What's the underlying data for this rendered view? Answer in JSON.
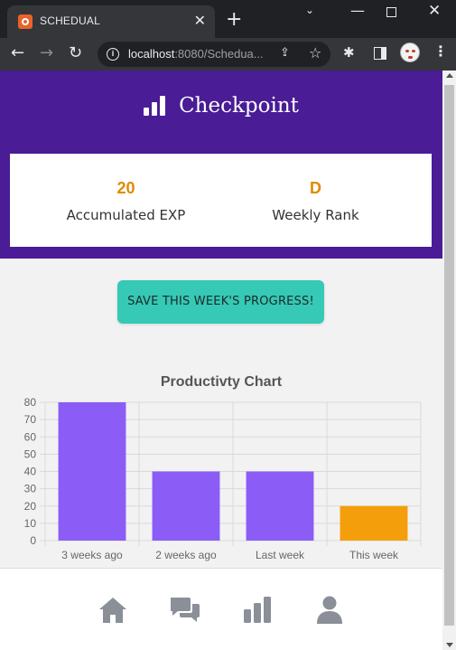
{
  "browser": {
    "tab_title": "SCHEDUAL",
    "url_host": "localhost",
    "url_rest": ":8080/Schedua...",
    "close_glyph": "✕",
    "new_tab_glyph": "+",
    "dropdown_glyph": "⌄",
    "min_glyph": "—",
    "win_close_glyph": "✕",
    "back_glyph": "←",
    "fwd_glyph": "→",
    "reload_glyph": "↻",
    "share_glyph": "⇪",
    "star_glyph": "☆",
    "puzzle_glyph": "✱",
    "menu_glyph": "⋮",
    "info_glyph": "i"
  },
  "header": {
    "title": "Checkpoint",
    "icon": "bar-chart-icon"
  },
  "stats": {
    "exp_value": "20",
    "exp_label": "Accumulated EXP",
    "rank_value": "D",
    "rank_label": "Weekly Rank"
  },
  "actions": {
    "save_label": "SAVE THIS WEEK'S PROGRESS!"
  },
  "chart_data": {
    "type": "bar",
    "title": "Productivty Chart",
    "categories": [
      "3 weeks ago",
      "2 weeks ago",
      "Last week",
      "This week"
    ],
    "values": [
      80,
      40,
      40,
      20
    ],
    "colors": [
      "#8b5cf6",
      "#8b5cf6",
      "#8b5cf6",
      "#f59e0b"
    ],
    "ylim": [
      0,
      80
    ],
    "yticks": [
      0,
      10,
      20,
      30,
      40,
      50,
      60,
      70,
      80
    ],
    "grid": true
  },
  "bottom_nav": [
    {
      "name": "home-icon"
    },
    {
      "name": "chat-icon"
    },
    {
      "name": "bar-chart-icon"
    },
    {
      "name": "profile-icon"
    }
  ],
  "colors": {
    "header_bg": "#4a1c96",
    "accent": "#e08a00",
    "button": "#35c9b6",
    "nav_icon": "#8a8f98"
  }
}
